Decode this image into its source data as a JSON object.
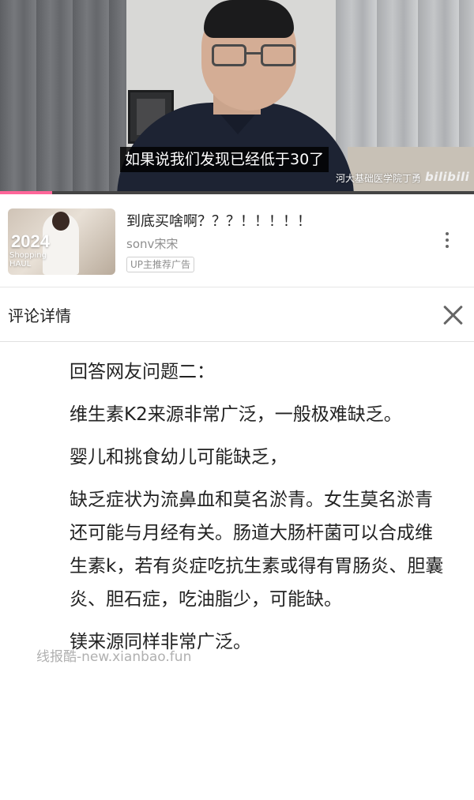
{
  "video": {
    "subtitle": "如果说我们发现已经低于30了",
    "watermark": "河大基础医学院丁勇",
    "logo": "bilibili",
    "progress_fraction": 0.11,
    "progress_color": "#ff6699"
  },
  "ad": {
    "thumb_year": "2024",
    "thumb_caption": "Shopping HAUL",
    "title": "到底买啥啊？？？！！！！！",
    "author": "sonv宋宋",
    "tag": "UP主推荐广告",
    "more_icon": "more-vertical-icon"
  },
  "comment": {
    "header_title": "评论详情",
    "close_icon": "close-icon",
    "paragraphs": [
      "回答网友问题二：",
      "维生素K2来源非常广泛，一般极难缺乏。",
      "婴儿和挑食幼儿可能缺乏，",
      "缺乏症状为流鼻血和莫名淤青。女生莫名淤青还可能与月经有关。肠道大肠杆菌可以合成维生素k，若有炎症吃抗生素或得有胃肠炎、胆囊炎、胆石症，吃油脂少，可能缺。",
      "镁来源同样非常广泛。"
    ]
  },
  "site_watermark": "线报酷-new.xianbao.fun"
}
